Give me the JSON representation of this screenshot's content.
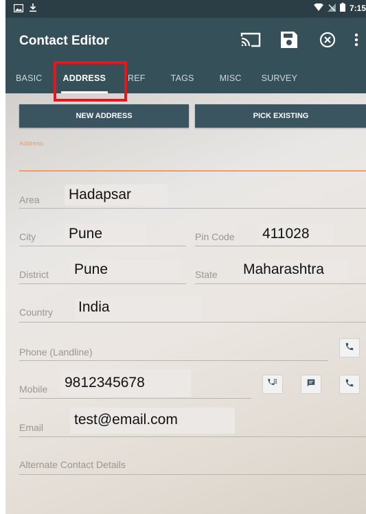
{
  "status": {
    "time": "7:15"
  },
  "app": {
    "title": "Contact Editor"
  },
  "icons": {
    "cast": "cast-icon",
    "save": "save-icon",
    "close": "close-circle-icon",
    "more": "more-vert-icon",
    "call": "phone-icon",
    "dialpad": "dialpad-icon",
    "sms": "message-icon"
  },
  "tabs": [
    {
      "label": "BASIC"
    },
    {
      "label": "ADDRESS"
    },
    {
      "label": "REF"
    },
    {
      "label": "TAGS"
    },
    {
      "label": "MISC"
    },
    {
      "label": "SURVEY"
    }
  ],
  "buttons": {
    "new_address": "NEW ADDRESS",
    "pick_existing": "PICK EXISTING"
  },
  "form": {
    "address_label": "Address",
    "area": {
      "label": "Area",
      "value": "Hadapsar"
    },
    "city": {
      "label": "City",
      "value": "Pune"
    },
    "pin_code": {
      "label": "Pin Code",
      "value": "411028"
    },
    "district": {
      "label": "District",
      "value": "Pune"
    },
    "state": {
      "label": "State",
      "value": "Maharashtra"
    },
    "country": {
      "label": "Country",
      "value": "India"
    },
    "phone_landline": {
      "label": "Phone (Landline)"
    },
    "mobile": {
      "label": "Mobile",
      "value": "9812345678"
    },
    "email": {
      "label": "Email",
      "value": "test@email.com"
    },
    "alternate": {
      "label": "Alternate Contact Details"
    }
  },
  "colors": {
    "appbar": "#36505a",
    "statusbar": "#2b3d45",
    "accent_orange": "#f19b63",
    "highlight_red": "#e4171f"
  }
}
